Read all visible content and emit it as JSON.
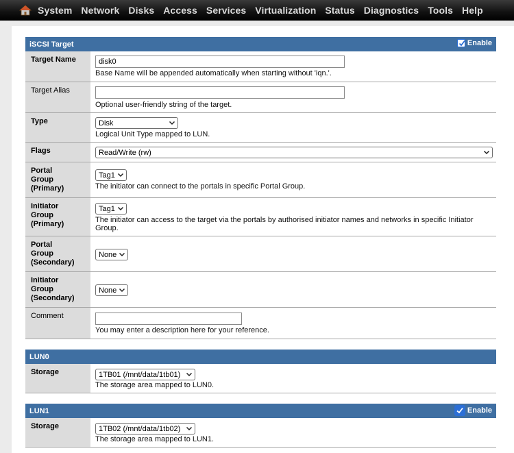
{
  "menu": {
    "home_icon": "home-icon",
    "items": [
      "System",
      "Network",
      "Disks",
      "Access",
      "Services",
      "Virtualization",
      "Status",
      "Diagnostics",
      "Tools",
      "Help"
    ]
  },
  "target_section": {
    "title": "iSCSI Target",
    "enable_label": "Enable",
    "enabled": true,
    "target_name": {
      "label": "Target Name",
      "value": "disk0",
      "hint": "Base Name will be appended automatically when starting without 'iqn.'."
    },
    "target_alias": {
      "label": "Target Alias",
      "value": "",
      "hint": "Optional user-friendly string of the target."
    },
    "type": {
      "label": "Type",
      "value": "Disk",
      "hint": "Logical Unit Type mapped to LUN."
    },
    "flags": {
      "label": "Flags",
      "value": "Read/Write (rw)"
    },
    "portal_group_primary": {
      "label": "Portal Group (Primary)",
      "value": "Tag1",
      "hint": "The initiator can connect to the portals in specific Portal Group."
    },
    "initiator_group_primary": {
      "label": "Initiator Group (Primary)",
      "value": "Tag1",
      "hint": "The initiator can access to the target via the portals by authorised initiator names and networks in specific Initiator Group."
    },
    "portal_group_secondary": {
      "label": "Portal Group (Secondary)",
      "value": "None"
    },
    "initiator_group_secondary": {
      "label": "Initiator Group (Secondary)",
      "value": "None"
    },
    "comment": {
      "label": "Comment",
      "value": "",
      "hint": "You may enter a description here for your reference."
    }
  },
  "lun0": {
    "title": "LUN0",
    "storage_label": "Storage",
    "storage_value": "1TB01 (/mnt/data/1tb01)",
    "hint": "The storage area mapped to LUN0."
  },
  "lun1": {
    "title": "LUN1",
    "enable_label": "Enable",
    "enabled": true,
    "storage_label": "Storage",
    "storage_value": "1TB02 (/mnt/data/1tb02)",
    "hint": "The storage area mapped to LUN1."
  },
  "colors": {
    "header_blue": "#3f6fa2",
    "label_gray": "#dcdcdc",
    "topbar_black": "#000000"
  }
}
